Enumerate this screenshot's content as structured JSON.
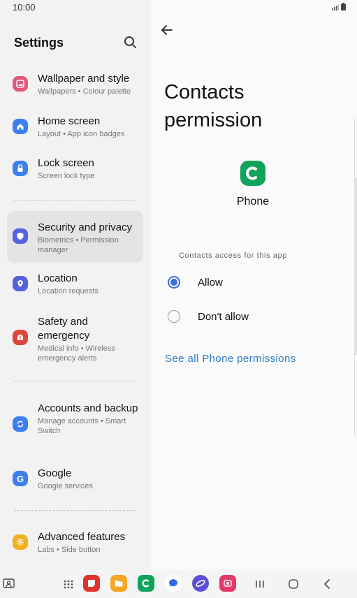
{
  "status_bar": {
    "time": "10:00"
  },
  "left_panel": {
    "title": "Settings",
    "items": [
      {
        "title": "Wallpaper and style",
        "subtitle": "Wallpapers  •  Colour palette",
        "icon": "wallpaper-icon",
        "color": "#e4577a"
      },
      {
        "title": "Home screen",
        "subtitle": "Layout  •  App icon badges",
        "icon": "home-icon",
        "color": "#3d7ef0"
      },
      {
        "title": "Lock screen",
        "subtitle": "Screen lock type",
        "icon": "lock-icon",
        "color": "#3d7ef0"
      },
      {
        "title": "Security and privacy",
        "subtitle": "Biometrics  •  Permission manager",
        "icon": "shield-icon",
        "color": "#5463e0"
      },
      {
        "title": "Location",
        "subtitle": "Location requests",
        "icon": "location-icon",
        "color": "#5463e0"
      },
      {
        "title": "Safety and emergency",
        "subtitle": "Medical info  •  Wireless emergency alerts",
        "icon": "emergency-icon",
        "color": "#e0453c"
      },
      {
        "title": "Accounts and backup",
        "subtitle": "Manage accounts  •  Smart Switch",
        "icon": "sync-icon",
        "color": "#3d7ef0"
      },
      {
        "title": "Google",
        "subtitle": "Google services",
        "icon": "google-icon",
        "color": "#3d7ef0"
      },
      {
        "title": "Advanced features",
        "subtitle": "Labs  •  Side button",
        "icon": "gear-icon",
        "color": "#f3b023"
      }
    ]
  },
  "detail": {
    "title": "Contacts permission",
    "app_name": "Phone",
    "section_label": "Contacts access for this app",
    "options": [
      {
        "label": "Allow",
        "selected": true
      },
      {
        "label": "Don't allow",
        "selected": false
      }
    ],
    "link": "See all Phone permissions",
    "accent_color": "#3a6fe0",
    "link_color": "#2f7bc4"
  },
  "taskbar": {
    "apps": [
      "edge-panel-icon",
      "app-drawer-icon",
      "notes-app-icon",
      "my-files-icon",
      "phone-app-icon",
      "messages-app-icon",
      "internet-app-icon",
      "screen-recorder-icon"
    ],
    "nav": [
      "recents-button",
      "home-button",
      "back-button"
    ]
  }
}
